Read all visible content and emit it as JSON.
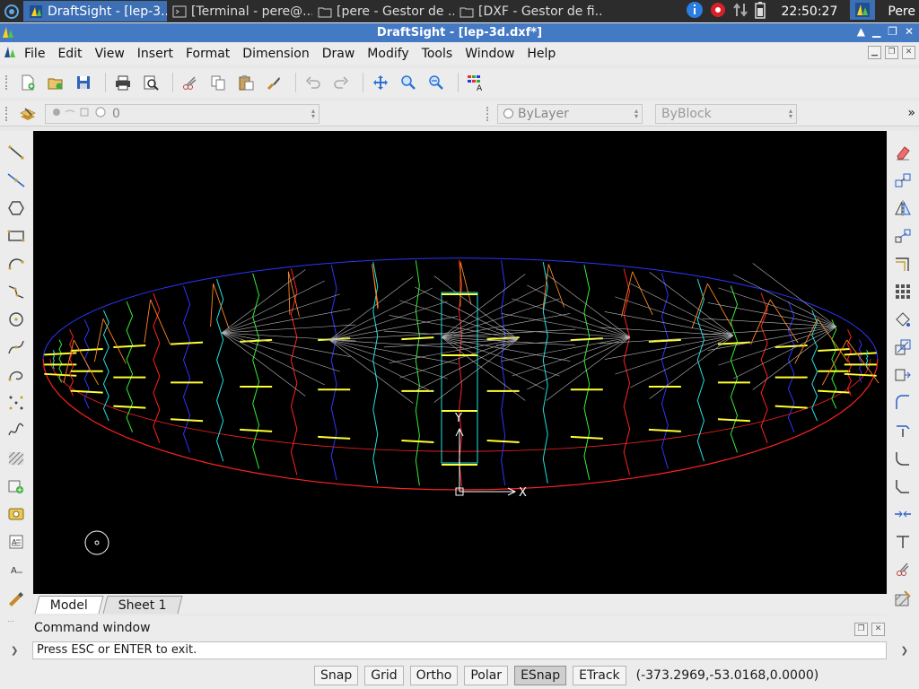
{
  "taskbar": {
    "tasks": [
      {
        "label": "DraftSight - [lep-3...",
        "icon": "draftsight-icon",
        "active": true
      },
      {
        "label": "[Terminal - pere@...",
        "icon": "terminal-icon",
        "active": false
      },
      {
        "label": "[pere - Gestor de ...",
        "icon": "folder-icon",
        "active": false
      },
      {
        "label": "[DXF - Gestor de fi...",
        "icon": "folder-icon",
        "active": false
      }
    ],
    "clock": "22:50:27",
    "user": "Pere"
  },
  "window": {
    "title": "DraftSight - [lep-3d.dxf*]"
  },
  "menu": {
    "items": [
      "File",
      "Edit",
      "View",
      "Insert",
      "Format",
      "Dimension",
      "Draw",
      "Modify",
      "Tools",
      "Window",
      "Help"
    ]
  },
  "layer_toolbar": {
    "layer_value": "0",
    "color_value": "ByLayer",
    "linestyle_value": "ByBlock"
  },
  "sheets": {
    "tabs": [
      "Model",
      "Sheet 1"
    ],
    "active": "Model"
  },
  "command": {
    "title": "Command window",
    "prompt": "Press ESC or ENTER to exit."
  },
  "status": {
    "buttons": [
      {
        "label": "Snap",
        "on": false
      },
      {
        "label": "Grid",
        "on": false
      },
      {
        "label": "Ortho",
        "on": false
      },
      {
        "label": "Polar",
        "on": false
      },
      {
        "label": "ESnap",
        "on": true
      },
      {
        "label": "ETrack",
        "on": false
      }
    ],
    "coordinates": "(-373.2969,-53.0168,0.0000)"
  },
  "canvas": {
    "ucs_x_label": "X",
    "ucs_y_label": "Y",
    "colors": {
      "blue": "#2d35ff",
      "red": "#ff2222",
      "yellow": "#ffff33",
      "green": "#33ee33",
      "cyan": "#22e0e0",
      "orange": "#ff8822",
      "gray": "#b8b8b8"
    }
  }
}
